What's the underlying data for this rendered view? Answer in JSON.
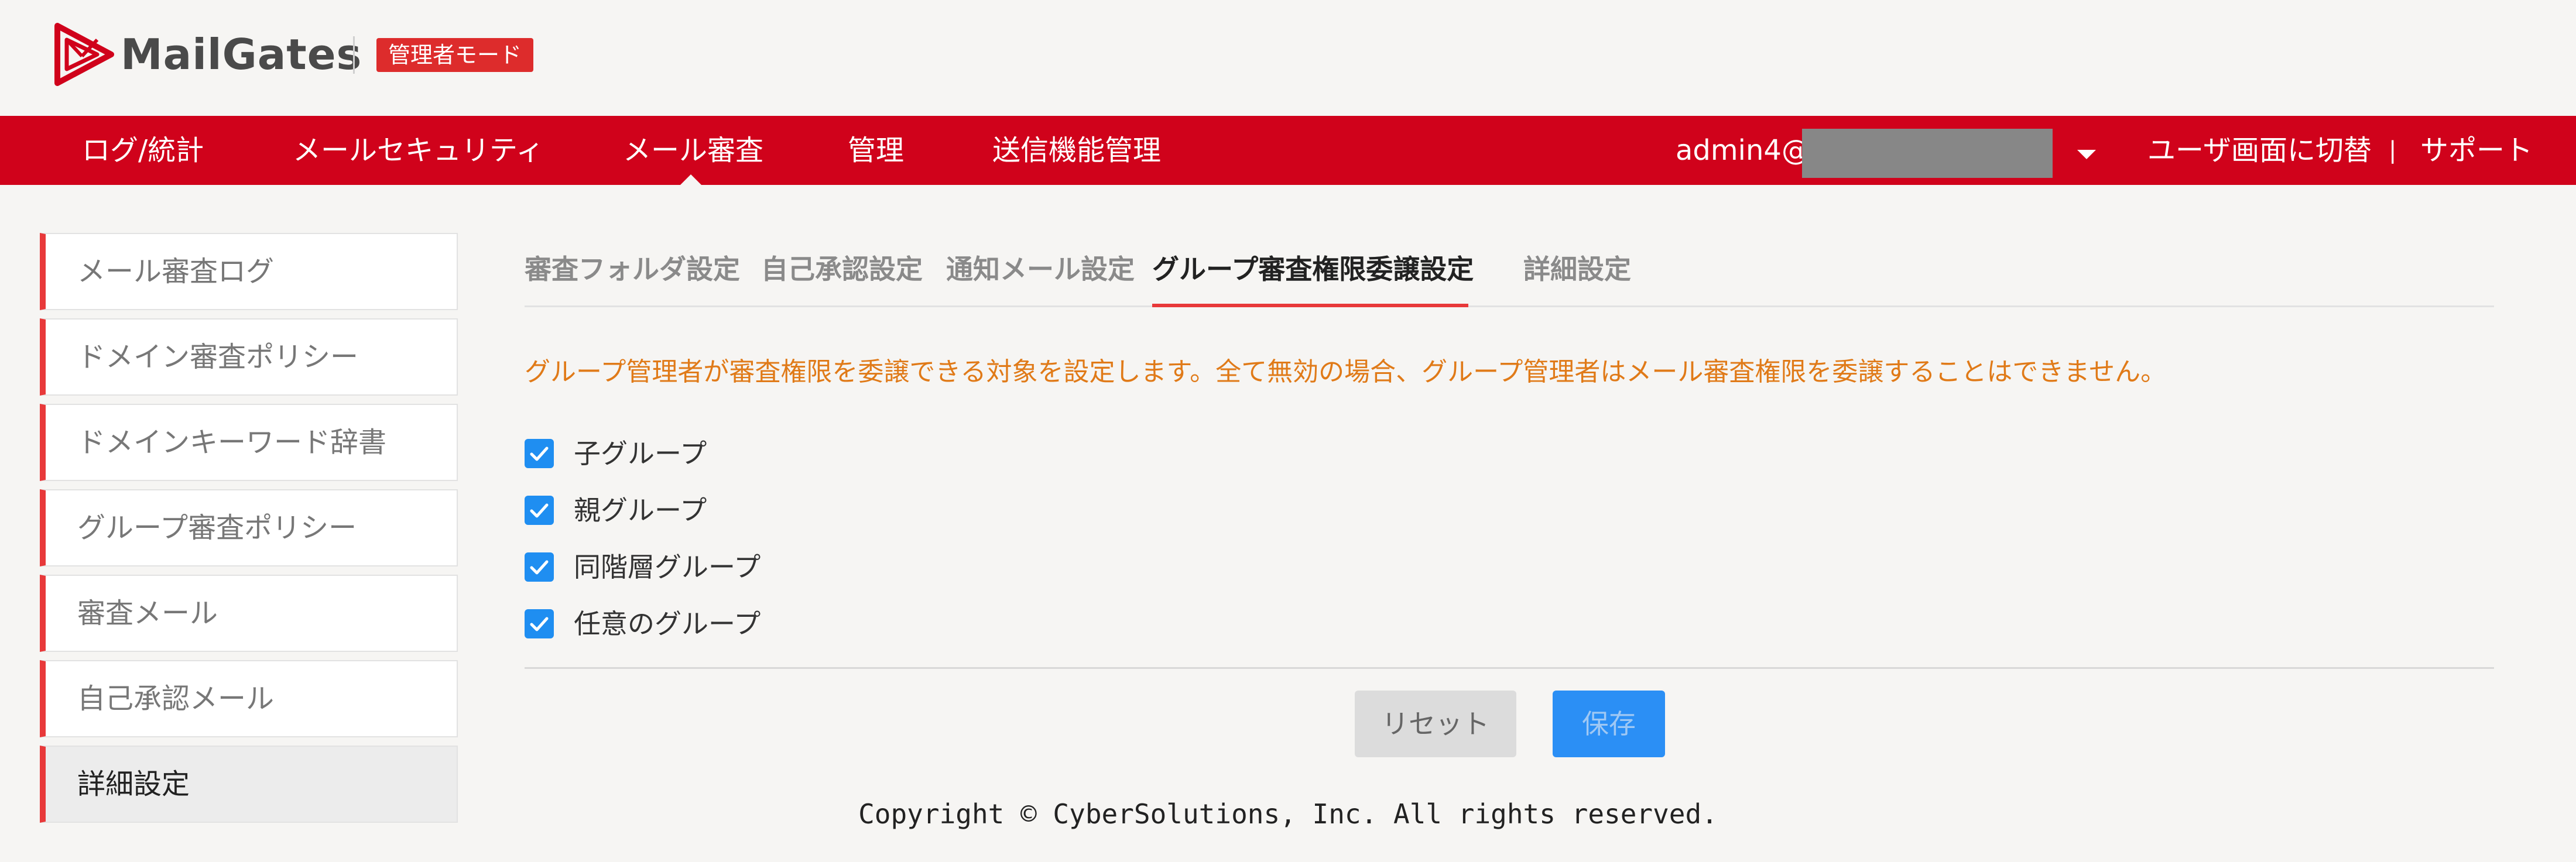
{
  "app": {
    "logo_text": "MailGates",
    "mode_badge": "管理者モード"
  },
  "topnav": {
    "items": [
      "ログ/統計",
      "メールセキュリティ",
      "メール審査",
      "管理",
      "送信機能管理"
    ],
    "active_item": "メール審査",
    "user_label": "admin4@",
    "switch_label": "ユーザ画面に切替",
    "separator": "|",
    "support_label": "サポート"
  },
  "sidebar": {
    "items": [
      {
        "label": "メール審査ログ"
      },
      {
        "label": "ドメイン審査ポリシー"
      },
      {
        "label": "ドメインキーワード辞書"
      },
      {
        "label": "グループ審査ポリシー"
      },
      {
        "label": "審査メール"
      },
      {
        "label": "自己承認メール"
      },
      {
        "label": "詳細設定"
      }
    ],
    "active_item": "詳細設定"
  },
  "tabs": {
    "items": [
      "審査フォルダ設定",
      "自己承認設定",
      "通知メール設定",
      "グループ審査権限委譲設定",
      "詳細設定"
    ],
    "active_item": "グループ審査権限委譲設定"
  },
  "main": {
    "description": "グループ管理者が審査権限を委譲できる対象を設定します。全て無効の場合、グループ管理者はメール審査権限を委譲することはできません。",
    "options": [
      {
        "label": "子グループ",
        "checked": true
      },
      {
        "label": "親グループ",
        "checked": true
      },
      {
        "label": "同階層グループ",
        "checked": true
      },
      {
        "label": "任意のグループ",
        "checked": true
      }
    ],
    "reset_label": "リセット",
    "save_label": "保存"
  },
  "footer": {
    "copyright": "Copyright © CyberSolutions, Inc. All rights reserved."
  },
  "colors": {
    "brand_red": "#d0021b",
    "accent_red": "#e8393a",
    "description_orange": "#e07a18",
    "checkbox_blue": "#1f8ef1",
    "save_blue": "#2b8ff5"
  }
}
